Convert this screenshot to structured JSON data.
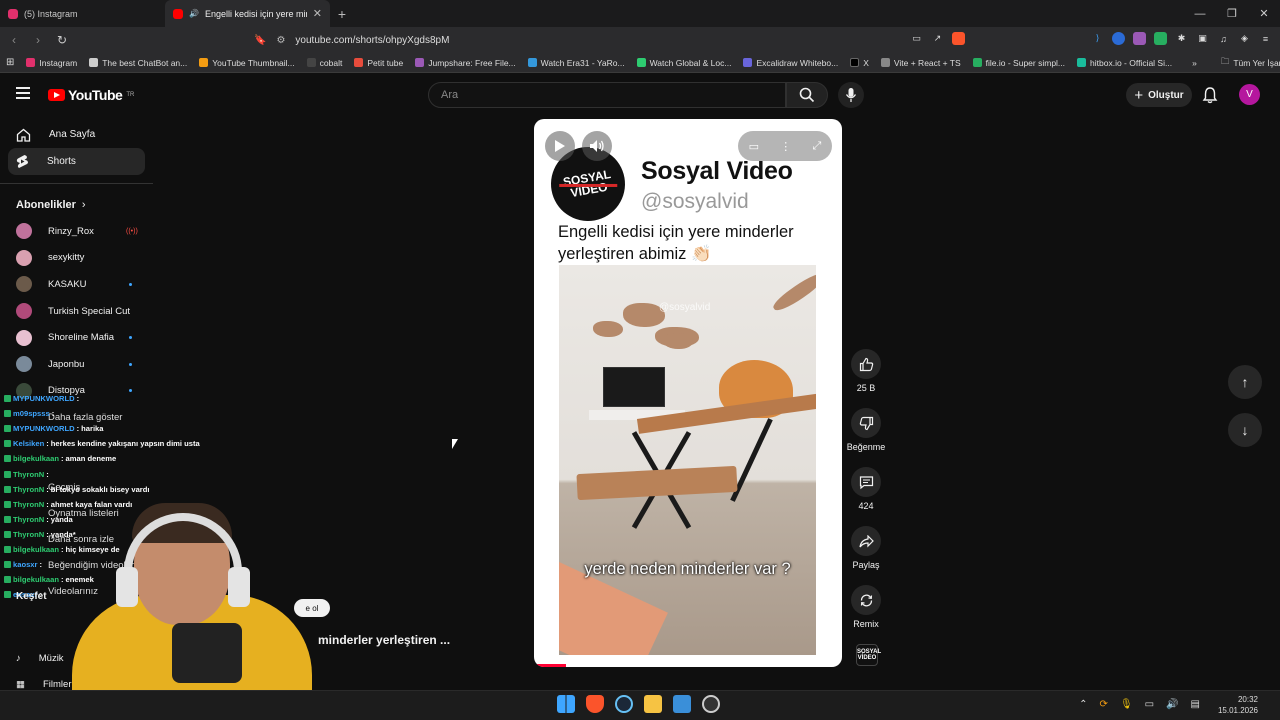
{
  "browser": {
    "tabs": [
      {
        "label": "(5) Instagram",
        "active": false,
        "color": "#e1306c"
      },
      {
        "label": "Engelli kedisi için yere minde",
        "active": true,
        "color": "#ff0000"
      }
    ],
    "url": "youtube.com/shorts/ohpyXgds8pM",
    "bookmarks": [
      {
        "label": "Instagram",
        "color": "#e1306c"
      },
      {
        "label": "The best ChatBot an...",
        "color": "#cccccc"
      },
      {
        "label": "YouTube Thumbnail...",
        "color": "#f39c12"
      },
      {
        "label": "cobalt",
        "color": "#222222"
      },
      {
        "label": "Petit tube",
        "color": "#e74c3c"
      },
      {
        "label": "Jumpshare: Free File...",
        "color": "#9b59b6"
      },
      {
        "label": "Watch Era31 - YaRo...",
        "color": "#3498db"
      },
      {
        "label": "Watch Global & Loc...",
        "color": "#2ecc71"
      },
      {
        "label": "Excalidraw Whitebo...",
        "color": "#6965db"
      },
      {
        "label": "X",
        "color": "#000000"
      },
      {
        "label": "Vite + React + TS",
        "color": "#888888"
      },
      {
        "label": "file.io - Super simpl...",
        "color": "#27ae60"
      },
      {
        "label": "hitbox.io - Official Si...",
        "color": "#1abc9c"
      }
    ],
    "all_bookmarks_label": "Tüm Yer İşaretleri"
  },
  "youtube": {
    "logo_text": "YouTube",
    "logo_region": "TR",
    "search_placeholder": "Ara",
    "create_label": "Oluştur",
    "avatar_letter": "V",
    "sidebar": {
      "home": "Ana Sayfa",
      "shorts": "Shorts",
      "subscriptions_title": "Abonelikler",
      "subscriptions": [
        {
          "name": "Rinzy_Rox",
          "status": "live",
          "color": "#c0729c"
        },
        {
          "name": "sexykitty",
          "status": "",
          "color": "#d9a0b0"
        },
        {
          "name": "KASAKU",
          "status": "dot",
          "color": "#6b5a4a"
        },
        {
          "name": "Turkish Special Cut",
          "status": "",
          "color": "#b04a7a"
        },
        {
          "name": "Shoreline Mafia",
          "status": "dot",
          "color": "#e8c0d0"
        },
        {
          "name": "Japonbu",
          "status": "dot",
          "color": "#7a8a9a"
        },
        {
          "name": "Distopya",
          "status": "dot",
          "color": "#3a4a3a"
        }
      ],
      "more_label": "Daha fazla göster",
      "hidden_items": [
        "Geçmiş",
        "Oynatma listeleri",
        "Daha sonra izle",
        "Beğendiğim videolar",
        "Videolarınız"
      ],
      "explore_title": "Keşfet",
      "explore_items": [
        "Müzik",
        "Filmler"
      ]
    },
    "short": {
      "channel_logo_text": "SOSYAL VİDEO",
      "channel_name": "Sosyal Video",
      "channel_handle": "@sosyalvid",
      "caption": "Engelli kedisi için yere minderler yerleştiren abimiz 👏🏻",
      "watermark": "@sosyalvid",
      "subtitle": "yerde neden minderler var ?",
      "below_title": "minderler yerleştiren ...",
      "subscribe_fragment": "e ol"
    },
    "actions": {
      "like_count": "25 B",
      "dislike_label": "Beğenme",
      "comment_count": "424",
      "share_label": "Paylaş",
      "remix_label": "Remix"
    }
  },
  "chat": [
    {
      "user": "MYPUNKWORLD",
      "msg": "",
      "color": "#3ea6ff"
    },
    {
      "user": "m09spsss",
      "msg": "",
      "color": "#3ea6ff"
    },
    {
      "user": "MYPUNKWORLD",
      "msg": "harika",
      "color": "#3ea6ff"
    },
    {
      "user": "Kelsiken",
      "msg": "herkes kendine yakışanı yapsın dimi usta",
      "color": "#3ea6ff"
    },
    {
      "user": "bilgekulkaan",
      "msg": "aman deneme",
      "color": "#2ecc71"
    },
    {
      "user": "ThyronN",
      "msg": "",
      "color": "#2ecc71"
    },
    {
      "user": "ThyronN",
      "msg": "bi tokyo sokaklı bisey vardı",
      "color": "#2ecc71"
    },
    {
      "user": "ThyronN",
      "msg": "ahmet kaya falan vardı",
      "color": "#2ecc71"
    },
    {
      "user": "ThyronN",
      "msg": "yanda",
      "color": "#2ecc71"
    },
    {
      "user": "ThyronN",
      "msg": "yanda*",
      "color": "#2ecc71"
    },
    {
      "user": "bilgekulkaan",
      "msg": "hiç kimseye de",
      "color": "#2ecc71"
    },
    {
      "user": "kaosxr",
      "msg": "",
      "color": "#3ea6ff"
    },
    {
      "user": "bilgekulkaan",
      "msg": "enemek",
      "color": "#2ecc71"
    },
    {
      "user": "ensaxr",
      "msg": "",
      "color": "#3ea6ff"
    }
  ],
  "taskbar": {
    "time": "20:32",
    "date": "15.01.2026"
  }
}
